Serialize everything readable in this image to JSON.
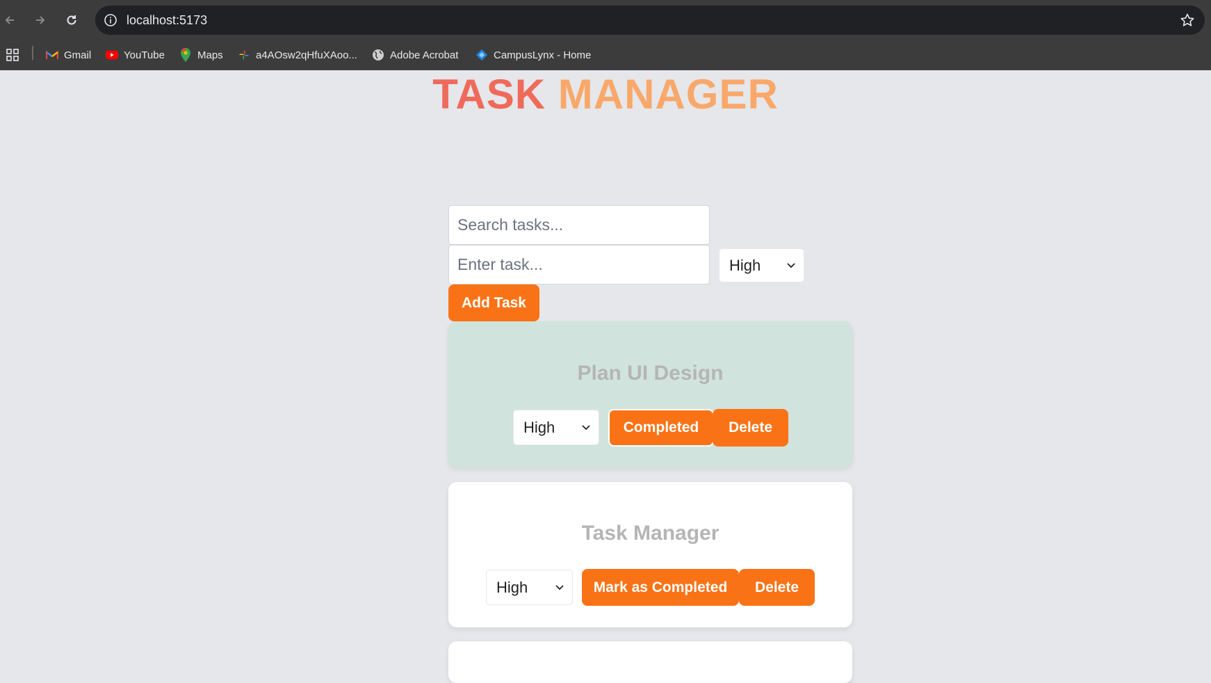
{
  "browser": {
    "url": "localhost:5173",
    "bookmarks": [
      {
        "label": "Gmail",
        "icon": "gmail-icon"
      },
      {
        "label": "YouTube",
        "icon": "youtube-icon"
      },
      {
        "label": "Maps",
        "icon": "maps-icon"
      },
      {
        "label": "a4AOsw2qHfuXAoo...",
        "icon": "photos-icon"
      },
      {
        "label": "Adobe Acrobat",
        "icon": "globe-icon"
      },
      {
        "label": "CampusLynx - Home",
        "icon": "campuslynx-icon"
      }
    ]
  },
  "app": {
    "title_part1": "TASK",
    "title_part2": "MANAGER",
    "search_placeholder": "Search tasks...",
    "task_placeholder": "Enter task...",
    "priority_selected": "High",
    "add_button": "Add Task"
  },
  "tasks": [
    {
      "title": "Plan UI Design",
      "priority": "High",
      "status_button": "Completed",
      "delete_button": "Delete",
      "completed": true
    },
    {
      "title": "Task Manager",
      "priority": "High",
      "status_button": "Mark as Completed",
      "delete_button": "Delete",
      "completed": false
    }
  ],
  "colors": {
    "accent": "#f97316",
    "completed_card": "#d1e3dd",
    "title_red": "#f06a5a",
    "title_orange": "#f9a86a"
  }
}
